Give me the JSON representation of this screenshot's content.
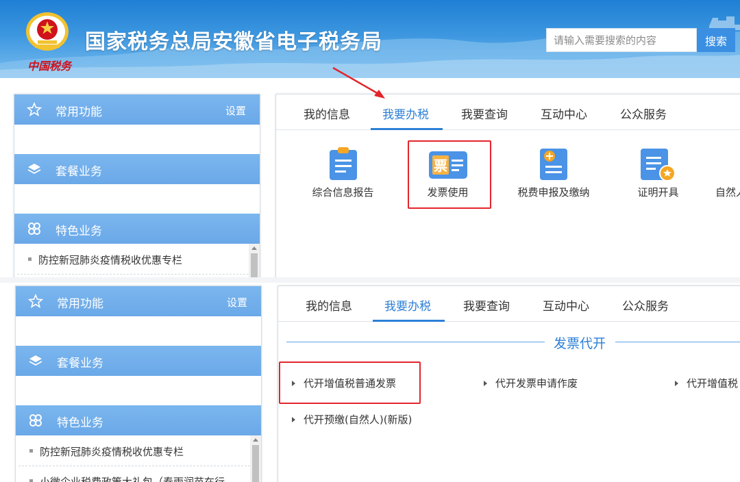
{
  "header": {
    "site_title": "国家税务总局安徽省电子税务局",
    "logo_script": "中国税务",
    "search_placeholder": "请输入需要搜索的内容",
    "search_button": "搜索"
  },
  "left_panel": {
    "sections": [
      {
        "label": "常用功能",
        "icon": "star-icon",
        "setting": "设置"
      },
      {
        "label": "套餐业务",
        "icon": "layers-icon"
      },
      {
        "label": "特色业务",
        "icon": "clover-icon"
      }
    ],
    "special_items": [
      "防控新冠肺炎疫情税收优惠专栏",
      "小微企业税费政策大礼包（春雨润苗在行"
    ]
  },
  "tabs": [
    "我的信息",
    "我要办税",
    "我要查询",
    "互动中心",
    "公众服务"
  ],
  "active_tab": "我要办税",
  "functions": [
    {
      "label": "综合信息报告",
      "icon": "report-icon"
    },
    {
      "label": "发票使用",
      "icon": "invoice-icon"
    },
    {
      "label": "税费申报及缴纳",
      "icon": "declare-icon"
    },
    {
      "label": "证明开具",
      "icon": "certificate-icon"
    },
    {
      "label": "自然人",
      "icon": ""
    }
  ],
  "invoice_section": {
    "title": "发票代开",
    "items": [
      "代开增值税普通发票",
      "代开发票申请作废",
      "代开增值税",
      "代开预缴(自然人)(新版)"
    ]
  },
  "colors": {
    "accent": "#2b7fd6",
    "section_bar": "#6aa8e8",
    "highlight": "#e3242b",
    "header_top": "#1f7fd4"
  }
}
